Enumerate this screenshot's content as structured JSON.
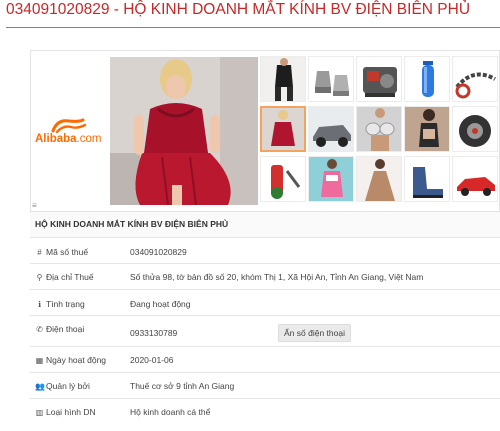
{
  "page": {
    "title": "034091020829 - HỘ KINH DOANH MẮT KÍNH BV ĐIỆN BIÊN PHỦ"
  },
  "ad": {
    "brand_main": "Alibaba",
    "brand_suffix": ".com",
    "marker": "≡",
    "accent_color": "#ff6a00",
    "product_images": [
      "red-lace-lingerie-photo",
      "black-bodysuit-photo",
      "metal-nozzle-parts-photo",
      "engine-photo",
      "blue-preform-tube-photo",
      "chain-photo",
      "red-lingerie-thumbnail",
      "car-photo",
      "crystal-bra-photo",
      "lingerie-model-photo",
      "wheel-hub-photo",
      "tool-set-photo",
      "pink-dress-photo",
      "evening-gown-photo",
      "blue-boots-photo",
      "red-car-photo"
    ]
  },
  "company": {
    "heading": "HỘ KINH DOANH MẮT KÍNH BV ĐIỆN BIÊN PHỦ",
    "tax_label": "Mã số thuế",
    "tax_value": "034091020829",
    "address_label": "Địa chỉ Thuế",
    "address_value": "Số thửa 98, tờ bản đồ số 20, khóm Thị 1, Xã Hội An, Tỉnh An Giang, Việt Nam",
    "status_label": "Tình trạng",
    "status_value": "Đang hoạt động",
    "phone_label": "Điện thoại",
    "phone_value": "0933130789",
    "hide_phone_button": "Ẩn số điện thoại",
    "start_label": "Ngày hoạt động",
    "start_value": "2020-01-06",
    "manager_label": "Quản lý bởi",
    "manager_value": "Thuế cơ sở 9 tỉnh An Giang",
    "type_label": "Loại hình DN",
    "type_value": "Hộ kinh doanh cá thể"
  },
  "colors": {
    "title": "#c62828",
    "rule": "#d45d5d",
    "selected_border": "#f5a25d"
  }
}
